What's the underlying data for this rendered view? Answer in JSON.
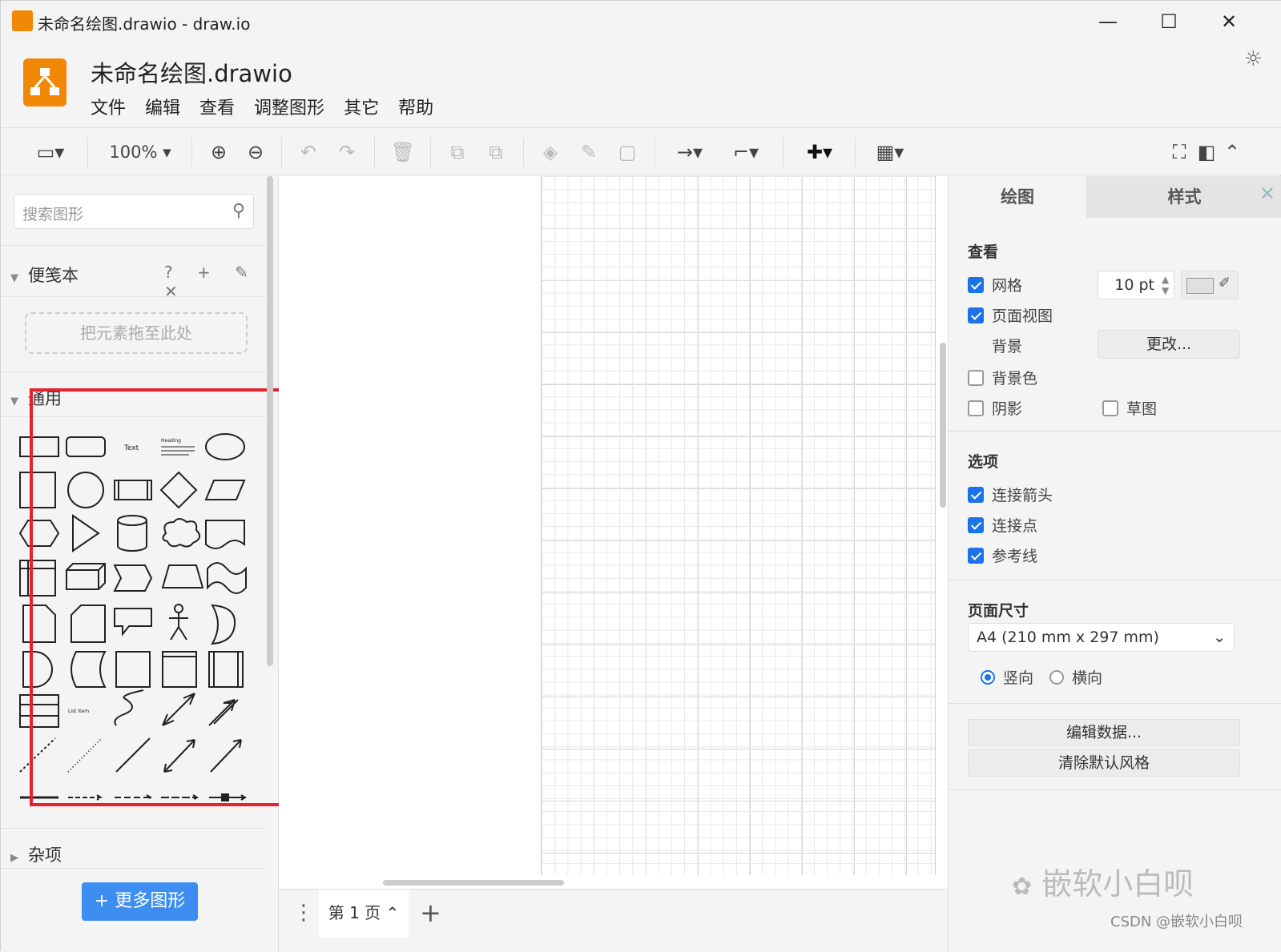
{
  "window": {
    "title": "未命名绘图.drawio - draw.io",
    "minimize": "—",
    "maximize": "☐",
    "close": "✕"
  },
  "header": {
    "doc_title": "未命名绘图.drawio",
    "menu": [
      "文件",
      "编辑",
      "查看",
      "调整图形",
      "其它",
      "帮助"
    ],
    "theme_icon": "sun-icon"
  },
  "toolbar": {
    "zoom": "100%"
  },
  "sidebar": {
    "search_placeholder": "搜索图形",
    "scratchpad": {
      "title": "便笺本",
      "tools": "? + ✎ ✕",
      "dropzone": "把元素拖至此处"
    },
    "general": {
      "title": "通用"
    },
    "misc": {
      "title": "杂项"
    },
    "more_shapes": "+ 更多图形",
    "shape_text_label": "Text",
    "shape_heading_label": "Heading",
    "shape_listitem_label": "List Item"
  },
  "pages": {
    "current": "第 1 页 ⌃"
  },
  "format_panel": {
    "tabs": [
      "绘图",
      "样式"
    ],
    "view": {
      "title": "查看",
      "grid": {
        "label": "网格",
        "checked": true,
        "size": "10 pt"
      },
      "page_view": {
        "label": "页面视图",
        "checked": true
      },
      "background": {
        "label": "背景",
        "button": "更改..."
      },
      "background_color": {
        "label": "背景色",
        "checked": false
      },
      "shadow": {
        "label": "阴影",
        "checked": false
      },
      "sketch": {
        "label": "草图",
        "checked": false
      }
    },
    "options": {
      "title": "选项",
      "connection_arrows": {
        "label": "连接箭头",
        "checked": true
      },
      "connection_points": {
        "label": "连接点",
        "checked": true
      },
      "guides": {
        "label": "参考线",
        "checked": true
      }
    },
    "page_size": {
      "title": "页面尺寸",
      "selected": "A4 (210 mm x 297 mm)",
      "portrait": "竖向",
      "landscape": "横向",
      "orientation": "portrait"
    },
    "edit_data": "编辑数据...",
    "clear_style": "清除默认风格"
  },
  "watermark": {
    "text": "嵌软小白呗",
    "credit": "CSDN @嵌软小白呗"
  },
  "colors": {
    "accent": "#1a73e8",
    "brand": "#f08705",
    "highlight": "#e4232c"
  }
}
